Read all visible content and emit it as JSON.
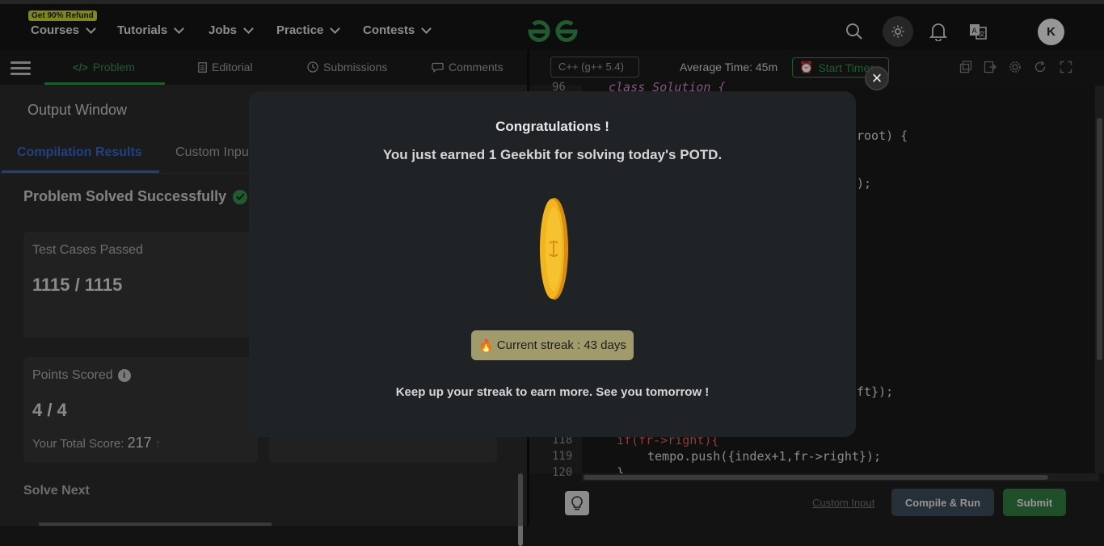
{
  "header": {
    "refund_badge": "Get 90% Refund",
    "nav": [
      "Courses",
      "Tutorials",
      "Jobs",
      "Practice",
      "Contests"
    ],
    "avatar_initial": "K"
  },
  "left_tabs": [
    "Problem",
    "Editorial",
    "Submissions",
    "Comments"
  ],
  "output_window": {
    "title": "Output Window",
    "tabs": [
      "Compilation Results",
      "Custom Input"
    ],
    "status": "Problem Solved Successfully",
    "test_cases_label": "Test Cases Passed",
    "test_cases_value": "1115 / 1115",
    "points_label": "Points Scored",
    "points_value": "4 / 4",
    "total_score_label": "Your Total Score:",
    "total_score_value": "217",
    "solve_next": "Solve Next"
  },
  "editor": {
    "language": "C++ (g++ 5.4)",
    "average_time": "Average Time: 45m",
    "start_timer": "Start Timer",
    "lines": [
      {
        "num": "96",
        "text": "class Solution {"
      },
      {
        "num": "",
        "text": "root) {"
      },
      {
        "num": "",
        "text": ");"
      },
      {
        "num": "",
        "text": "ft});"
      },
      {
        "num": "118",
        "text": "if(fr->right){"
      },
      {
        "num": "119",
        "text": "tempo.push({index+1,fr->right});"
      },
      {
        "num": "120",
        "text": "}"
      }
    ],
    "custom_input": "Custom Input",
    "compile_run": "Compile & Run",
    "submit": "Submit"
  },
  "modal": {
    "title": "Congratulations !",
    "subtitle": "You just earned 1 Geekbit for solving today's POTD.",
    "streak": "Current streak : 43 days",
    "footer": "Keep up your streak to earn more. See you tomorrow !",
    "close": "×"
  },
  "colors": {
    "brand_green": "#2f8d46",
    "tab_blue": "#2e66c7",
    "streak_bg": "#a19a6a",
    "coin_gold": "#f2b51e"
  }
}
